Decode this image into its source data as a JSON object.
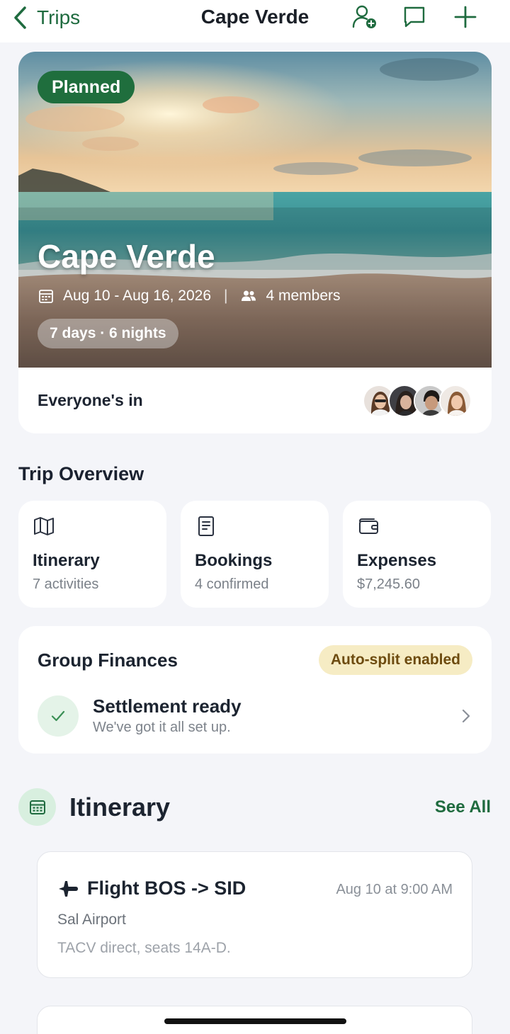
{
  "nav": {
    "back_label": "Trips",
    "title": "Cape Verde",
    "icons": [
      "add-person-icon",
      "chat-icon",
      "plus-icon"
    ],
    "accent_color": "#1f6b3f"
  },
  "trip": {
    "status": "Planned",
    "name": "Cape Verde",
    "dates": "Aug 10 - Aug 16, 2026",
    "members": "4 members",
    "duration": "7 days · 6 nights",
    "members_status": "Everyone's in"
  },
  "overview": {
    "title": "Trip Overview",
    "cards": [
      {
        "icon": "map-icon",
        "label": "Itinerary",
        "sub": "7 activities"
      },
      {
        "icon": "document-icon",
        "label": "Bookings",
        "sub": "4 confirmed"
      },
      {
        "icon": "wallet-icon",
        "label": "Expenses",
        "sub": "$7,245.60"
      }
    ]
  },
  "finances": {
    "title": "Group Finances",
    "badge": "Auto-split enabled",
    "settlement_title": "Settlement ready",
    "settlement_sub": "We've got it all set up."
  },
  "itinerary": {
    "title": "Itinerary",
    "see_all": "See All",
    "events": [
      {
        "icon": "plane-icon",
        "title": "Flight BOS -> SID",
        "time": "Aug 10 at 9:00 AM",
        "location": "Sal Airport",
        "note": "TACV direct, seats 14A-D."
      }
    ]
  }
}
